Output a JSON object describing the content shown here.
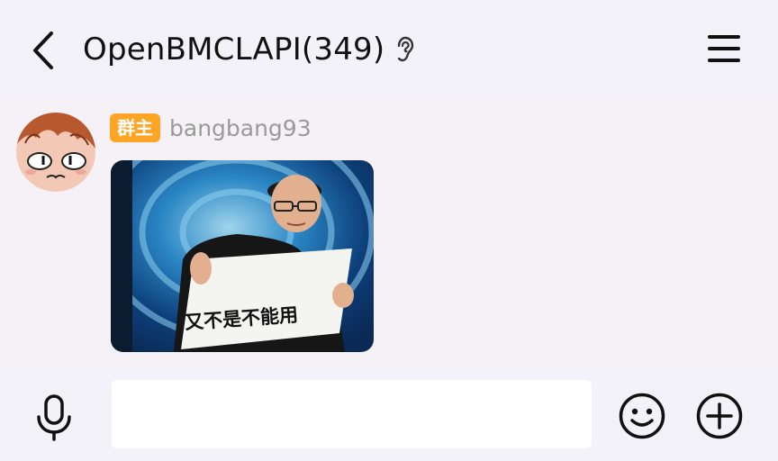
{
  "header": {
    "title": "OpenBMCLAPI(349)",
    "back_icon": "chevron-left-icon",
    "ear_icon": "ear-icon",
    "menu_icon": "hamburger-menu-icon"
  },
  "message": {
    "role_badge": "群主",
    "role_badge_color": "#ffa424",
    "sender": "bangbang93",
    "sticker_caption": "又不是不能用"
  },
  "input_bar": {
    "mic_icon": "microphone-icon",
    "text_value": "",
    "emoji_icon": "smiley-icon",
    "plus_icon": "plus-circle-icon"
  },
  "colors": {
    "header_bg": "#f3f2f9",
    "chat_bg": "#f6f1f6",
    "badge": "#ffa424",
    "sender_text": "#9a9a9a"
  }
}
